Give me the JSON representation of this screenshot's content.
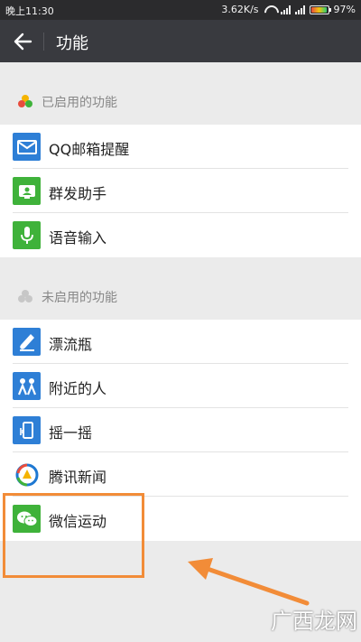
{
  "status_bar": {
    "time": "晚上11:30",
    "network_speed": "3.62K/s",
    "battery": "97%",
    "battery_level": 0.97
  },
  "header": {
    "title": "功能",
    "back_icon": "back-arrow-icon"
  },
  "sections": [
    {
      "title": "已启用的功能",
      "items": [
        {
          "label": "QQ邮箱提醒",
          "icon": "mail-icon",
          "icon_color": "#2e7fd6"
        },
        {
          "label": "群发助手",
          "icon": "broadcast-icon",
          "icon_color": "#3fb23a"
        },
        {
          "label": "语音输入",
          "icon": "microphone-icon",
          "icon_color": "#3fb23a"
        }
      ]
    },
    {
      "title": "未启用的功能",
      "items": [
        {
          "label": "漂流瓶",
          "icon": "bottle-icon",
          "icon_color": "#2e7fd6"
        },
        {
          "label": "附近的人",
          "icon": "people-nearby-icon",
          "icon_color": "#2e7fd6"
        },
        {
          "label": "摇一摇",
          "icon": "shake-icon",
          "icon_color": "#2e7fd6"
        },
        {
          "label": "腾讯新闻",
          "icon": "tencent-news-icon",
          "icon_color": "#ffffff"
        },
        {
          "label": "微信运动",
          "icon": "wechat-sport-icon",
          "icon_color": "#3fb23a"
        }
      ]
    }
  ],
  "annotation": {
    "highlight_color": "#f28c38"
  },
  "watermark": {
    "text": "广西龙网"
  }
}
